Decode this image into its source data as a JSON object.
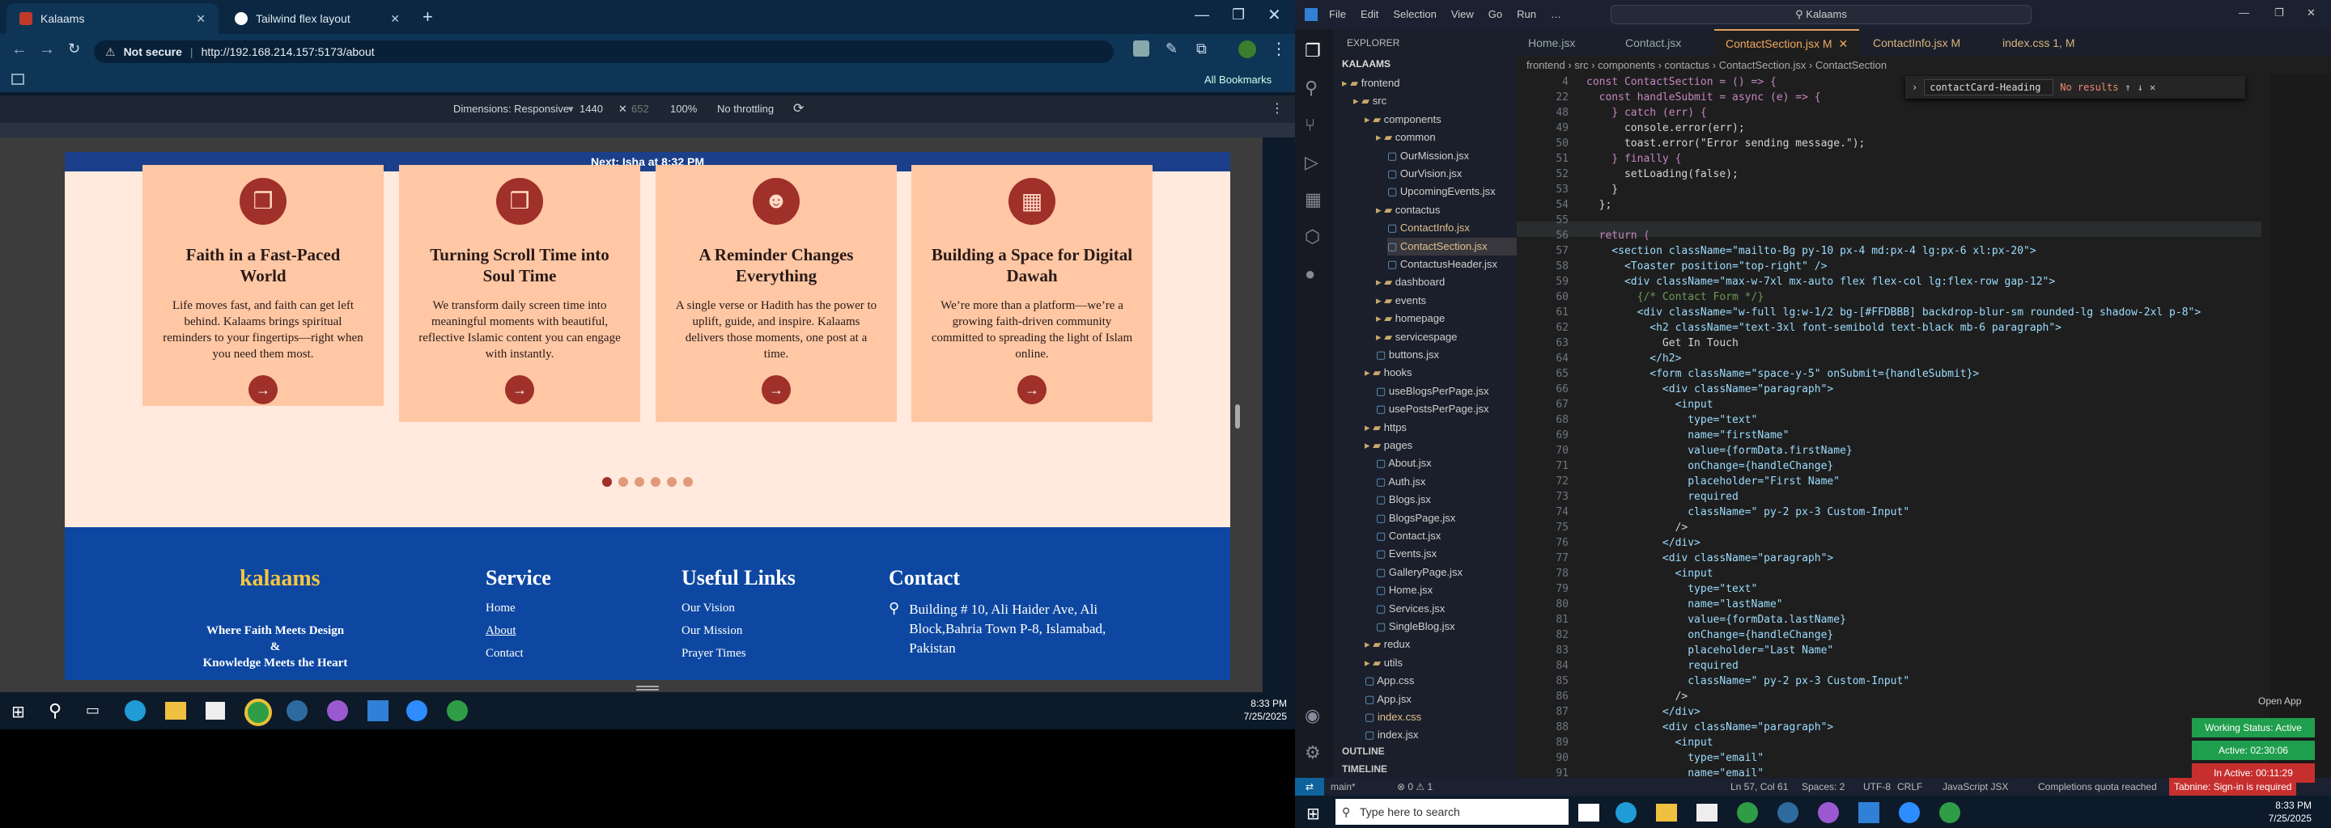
{
  "browser": {
    "tabs": [
      {
        "title": "Kalaams",
        "active": true
      },
      {
        "title": "Tailwind flex layout",
        "active": false
      }
    ],
    "address": {
      "not_secure": "Not secure",
      "url": "http://192.168.214.157:5173/about"
    },
    "bookmarks": "All Bookmarks",
    "devtools": {
      "dimensions": "Dimensions: Responsive",
      "width": "1440",
      "height": "652",
      "zoom": "100%",
      "throttle": "No throttling"
    }
  },
  "site": {
    "next_prayer": "Next: Isha at 8:32 PM",
    "cards": [
      {
        "title": "Faith in a Fast-Paced World",
        "text": "Life moves fast, and faith can get left behind. Kalaams brings spiritual reminders to your fingertips—right when you need them most.",
        "icon": "quran-icon"
      },
      {
        "title": "Turning Scroll Time into Soul Time",
        "text": "We transform daily screen time into meaningful moments with beautiful, reflective Islamic content you can engage with instantly.",
        "icon": "book-icon"
      },
      {
        "title": "A Reminder Changes Everything",
        "text": "A single verse or Hadith has the power to uplift, guide, and inspire. Kalaams delivers those moments, one post at a time.",
        "icon": "users-icon"
      },
      {
        "title": "Building a Space for Digital Dawah",
        "text": "We’re more than a platform—we’re a growing faith-driven community committed to spreading the light of Islam online.",
        "icon": "calendar-icon"
      }
    ],
    "arrow": "→",
    "footer": {
      "logo": "kalaams",
      "tagline1": "Where Faith Meets Design",
      "tagline2": "&",
      "tagline3": "Knowledge Meets the Heart",
      "service": {
        "title": "Service",
        "items": [
          "Home",
          "About",
          "Contact"
        ]
      },
      "links": {
        "title": "Useful Links",
        "items": [
          "Our Vision",
          "Our Mission",
          "Prayer Times"
        ]
      },
      "contact": {
        "title": "Contact",
        "address": "Building # 10, Ali Haider Ave, Ali Block,Bahria Town P-8, Islamabad, Pakistan"
      }
    }
  },
  "taskbar_left": {
    "time": "8:33 PM",
    "date": "7/25/2025"
  },
  "vscode": {
    "title": "Kalaams",
    "menu": [
      "File",
      "Edit",
      "Selection",
      "View",
      "Go",
      "Run",
      "…"
    ],
    "explorer_title": "EXPLORER",
    "root": "KALAAMS",
    "tabs": [
      "Home.jsx",
      "Contact.jsx",
      "ContactSection.jsx M",
      "ContactInfo.jsx M",
      "index.css 1, M"
    ],
    "breadcrumb": "frontend › src › components › contactus › ContactSection.jsx › ContactSection",
    "find": {
      "query": "contactCard-Heading",
      "result": "No results"
    },
    "tree": [
      [
        "frontend",
        0,
        "folder"
      ],
      [
        "src",
        1,
        "folder"
      ],
      [
        "components",
        2,
        "folder"
      ],
      [
        "common",
        3,
        "folder"
      ],
      [
        "OurMission.jsx",
        4,
        "file"
      ],
      [
        "OurVision.jsx",
        4,
        "file"
      ],
      [
        "UpcomingEvents.jsx",
        4,
        "file"
      ],
      [
        "contactus",
        3,
        "folder"
      ],
      [
        "ContactInfo.jsx",
        4,
        "file M"
      ],
      [
        "ContactSection.jsx",
        4,
        "file M sel"
      ],
      [
        "ContactusHeader.jsx",
        4,
        "file"
      ],
      [
        "dashboard",
        3,
        "folder"
      ],
      [
        "events",
        3,
        "folder"
      ],
      [
        "homepage",
        3,
        "folder"
      ],
      [
        "servicespage",
        3,
        "folder"
      ],
      [
        "buttons.jsx",
        3,
        "file"
      ],
      [
        "hooks",
        2,
        "folder"
      ],
      [
        "useBlogsPerPage.jsx",
        3,
        "file"
      ],
      [
        "usePostsPerPage.jsx",
        3,
        "file"
      ],
      [
        "https",
        2,
        "folder"
      ],
      [
        "pages",
        2,
        "folder"
      ],
      [
        "About.jsx",
        3,
        "file"
      ],
      [
        "Auth.jsx",
        3,
        "file"
      ],
      [
        "Blogs.jsx",
        3,
        "file"
      ],
      [
        "BlogsPage.jsx",
        3,
        "file"
      ],
      [
        "Contact.jsx",
        3,
        "file"
      ],
      [
        "Events.jsx",
        3,
        "file"
      ],
      [
        "GalleryPage.jsx",
        3,
        "file"
      ],
      [
        "Home.jsx",
        3,
        "file"
      ],
      [
        "Services.jsx",
        3,
        "file"
      ],
      [
        "SingleBlog.jsx",
        3,
        "file"
      ],
      [
        "redux",
        2,
        "folder"
      ],
      [
        "utils",
        2,
        "folder"
      ],
      [
        "App.css",
        2,
        "file"
      ],
      [
        "App.jsx",
        2,
        "file"
      ],
      [
        "index.css",
        2,
        "file M"
      ],
      [
        "index.jsx",
        2,
        "file"
      ]
    ],
    "outline": "OUTLINE",
    "timeline": "TIMELINE",
    "code": [
      [
        4,
        "const ContactSection = () => {"
      ],
      [
        22,
        "  const handleSubmit = async (e) => {"
      ],
      [
        48,
        "    } catch (err) {"
      ],
      [
        49,
        "      console.error(err);"
      ],
      [
        50,
        "      toast.error(\"Error sending message.\");"
      ],
      [
        51,
        "    } finally {"
      ],
      [
        52,
        "      setLoading(false);"
      ],
      [
        53,
        "    }"
      ],
      [
        54,
        "  };"
      ],
      [
        55,
        ""
      ],
      [
        56,
        "  return ("
      ],
      [
        57,
        "    <section className=\"mailto-Bg py-10 px-4 md:px-4 lg:px-6 xl:px-20\">"
      ],
      [
        58,
        "      <Toaster position=\"top-right\" />"
      ],
      [
        59,
        "      <div className=\"max-w-7xl mx-auto flex flex-col lg:flex-row gap-12\">"
      ],
      [
        60,
        "        {/* Contact Form */}"
      ],
      [
        61,
        "        <div className=\"w-full lg:w-1/2 bg-[#FFDBBB] backdrop-blur-sm rounded-lg shadow-2xl p-8\">"
      ],
      [
        62,
        "          <h2 className=\"text-3xl font-semibold text-black mb-6 paragraph\">"
      ],
      [
        63,
        "            Get In Touch"
      ],
      [
        64,
        "          </h2>"
      ],
      [
        65,
        "          <form className=\"space-y-5\" onSubmit={handleSubmit}>"
      ],
      [
        66,
        "            <div className=\"paragraph\">"
      ],
      [
        67,
        "              <input"
      ],
      [
        68,
        "                type=\"text\""
      ],
      [
        69,
        "                name=\"firstName\""
      ],
      [
        70,
        "                value={formData.firstName}"
      ],
      [
        71,
        "                onChange={handleChange}"
      ],
      [
        72,
        "                placeholder=\"First Name\""
      ],
      [
        73,
        "                required"
      ],
      [
        74,
        "                className=\" py-2 px-3 Custom-Input\""
      ],
      [
        75,
        "              />"
      ],
      [
        76,
        "            </div>"
      ],
      [
        77,
        "            <div className=\"paragraph\">"
      ],
      [
        78,
        "              <input"
      ],
      [
        79,
        "                type=\"text\""
      ],
      [
        80,
        "                name=\"lastName\""
      ],
      [
        81,
        "                value={formData.lastName}"
      ],
      [
        82,
        "                onChange={handleChange}"
      ],
      [
        83,
        "                placeholder=\"Last Name\""
      ],
      [
        84,
        "                required"
      ],
      [
        85,
        "                className=\" py-2 px-3 Custom-Input\""
      ],
      [
        86,
        "              />"
      ],
      [
        87,
        "            </div>"
      ],
      [
        88,
        "            <div className=\"paragraph\">"
      ],
      [
        89,
        "              <input"
      ],
      [
        90,
        "                type=\"email\""
      ],
      [
        91,
        "                name=\"email\""
      ]
    ],
    "status": {
      "branch": "main*",
      "errors": "⊗ 0 ⚠ 1",
      "position": "Ln 57, Col 61",
      "spaces": "Spaces: 2",
      "enc": "UTF-8",
      "eol": "CRLF",
      "lang": "JavaScript JSX",
      "quota": "Completions quota reached",
      "tabnine": "Tabnine: Sign-in is required"
    },
    "toasts": {
      "open_app": "Open App",
      "working": "Working Status: Active",
      "active": "Active: 02:30:06",
      "inactive": "In Active: 00:11:29"
    }
  },
  "taskbar_right": {
    "search": "Type here to search",
    "time": "8:33 PM",
    "date": "7/25/2025"
  }
}
